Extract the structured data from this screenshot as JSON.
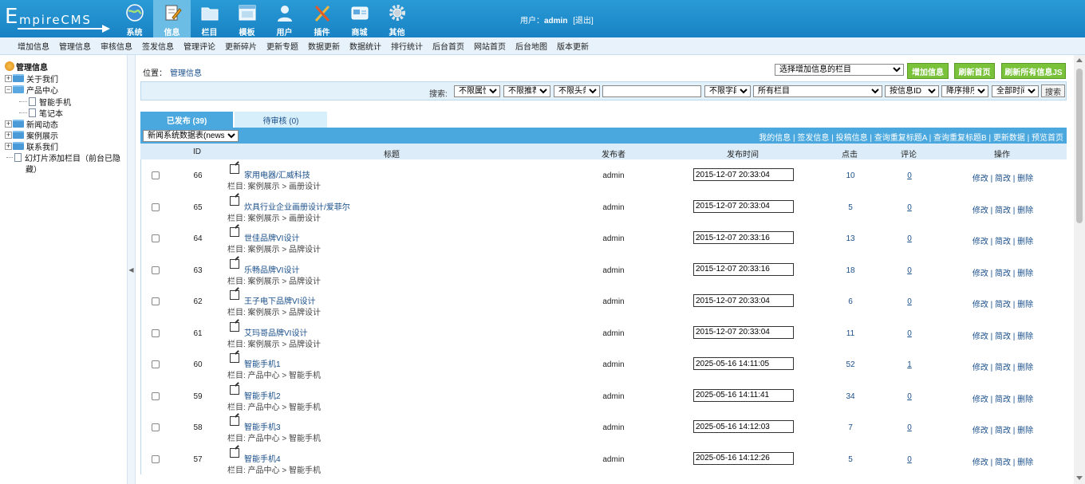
{
  "header": {
    "logo_text": "EmpireCMS",
    "logo_first": "E",
    "logo_rest": "mpireCMS",
    "nav": [
      {
        "label": "系统",
        "icon": "globe-icon"
      },
      {
        "label": "信息",
        "icon": "edit-document-icon"
      },
      {
        "label": "栏目",
        "icon": "folder-icon"
      },
      {
        "label": "模板",
        "icon": "template-window-icon"
      },
      {
        "label": "用户",
        "icon": "user-icon"
      },
      {
        "label": "插件",
        "icon": "tools-icon"
      },
      {
        "label": "商城",
        "icon": "shop-card-icon"
      },
      {
        "label": "其他",
        "icon": "gear-icon"
      }
    ],
    "active_nav": "信息",
    "user_prefix": "用户：",
    "username": "admin",
    "logout": "[退出]"
  },
  "subnav": [
    "增加信息",
    "管理信息",
    "审核信息",
    "签发信息",
    "管理评论",
    "更新碎片",
    "更新专题",
    "数据更新",
    "数据统计",
    "排行统计",
    "后台首页",
    "网站首页",
    "后台地图",
    "版本更新"
  ],
  "sidebar": {
    "root": "管理信息",
    "items": [
      {
        "label": "关于我们"
      },
      {
        "label": "产品中心"
      },
      {
        "label": "智能手机"
      },
      {
        "label": "笔记本"
      },
      {
        "label": "新闻动态"
      },
      {
        "label": "案例展示"
      },
      {
        "label": "联系我们"
      },
      {
        "label": "幻灯片添加栏目（前台已隐"
      },
      {
        "label": "藏）"
      }
    ]
  },
  "main": {
    "location_label": "位置：",
    "location_link": "管理信息",
    "add_column_select": "选择增加信息的栏目",
    "buttons": {
      "add": "增加信息",
      "refresh_home": "刷新首页",
      "refresh_js": "刷新所有信息JS"
    },
    "search": {
      "label": "搜索:",
      "attr": "不限属性",
      "recommend": "不限推荐",
      "headline": "不限头条",
      "keyword": "",
      "field": "不限字段",
      "column": "所有栏目",
      "order_by": "按信息ID",
      "order": "降序排序",
      "time": "全部时间",
      "button": "搜索"
    },
    "tabs": {
      "published": "已发布 (39)",
      "pending": "待审核 (0)"
    },
    "db_select": "新闻系统数据表(news)",
    "head_links": [
      "我的信息",
      "签发信息",
      "投稿信息",
      "查询重复标题A",
      "查询重复标题B",
      "更新数据",
      "预览首页"
    ],
    "columns": {
      "id": "ID",
      "title": "标题",
      "publisher": "发布者",
      "time": "发布时间",
      "hits": "点击",
      "comments": "评论",
      "ops": "操作"
    },
    "ops": {
      "edit": "修改",
      "simple_edit": "简改",
      "delete": "删除",
      "sep": " | "
    },
    "rows": [
      {
        "id": "66",
        "title": "家用电器/汇威科技",
        "cat": "栏目: 案例展示 > 画册设计",
        "pub": "admin",
        "time": "2015-12-07 20:33:04",
        "hits": "10",
        "comm": "0"
      },
      {
        "id": "65",
        "title": "炊具行业企业画册设计/爱菲尔",
        "cat": "栏目: 案例展示 > 画册设计",
        "pub": "admin",
        "time": "2015-12-07 20:33:04",
        "hits": "5",
        "comm": "0"
      },
      {
        "id": "64",
        "title": "世佳品牌VI设计",
        "cat": "栏目: 案例展示 > 品牌设计",
        "pub": "admin",
        "time": "2015-12-07 20:33:16",
        "hits": "13",
        "comm": "0"
      },
      {
        "id": "63",
        "title": "乐畅品牌VI设计",
        "cat": "栏目: 案例展示 > 品牌设计",
        "pub": "admin",
        "time": "2015-12-07 20:33:16",
        "hits": "18",
        "comm": "0"
      },
      {
        "id": "62",
        "title": "王子电下品牌VI设计",
        "cat": "栏目: 案例展示 > 品牌设计",
        "pub": "admin",
        "time": "2015-12-07 20:33:04",
        "hits": "6",
        "comm": "0"
      },
      {
        "id": "61",
        "title": "艾玛哥品牌VI设计",
        "cat": "栏目: 案例展示 > 品牌设计",
        "pub": "admin",
        "time": "2015-12-07 20:33:04",
        "hits": "11",
        "comm": "0"
      },
      {
        "id": "60",
        "title": "智能手机1",
        "cat": "栏目: 产品中心 > 智能手机",
        "pub": "admin",
        "time": "2025-05-16 14:11:05",
        "hits": "52",
        "comm": "1"
      },
      {
        "id": "59",
        "title": "智能手机2",
        "cat": "栏目: 产品中心 > 智能手机",
        "pub": "admin",
        "time": "2025-05-16 14:11:41",
        "hits": "34",
        "comm": "0"
      },
      {
        "id": "58",
        "title": "智能手机3",
        "cat": "栏目: 产品中心 > 智能手机",
        "pub": "admin",
        "time": "2025-05-16 14:12:03",
        "hits": "7",
        "comm": "0"
      },
      {
        "id": "57",
        "title": "智能手机4",
        "cat": "栏目: 产品中心 > 智能手机",
        "pub": "admin",
        "time": "2025-05-16 14:12:26",
        "hits": "5",
        "comm": "0"
      }
    ]
  },
  "colors": {
    "header": "#1f8ecf",
    "accent": "#4aa8de",
    "green": "#79c23a",
    "link": "#1a4f8a"
  }
}
